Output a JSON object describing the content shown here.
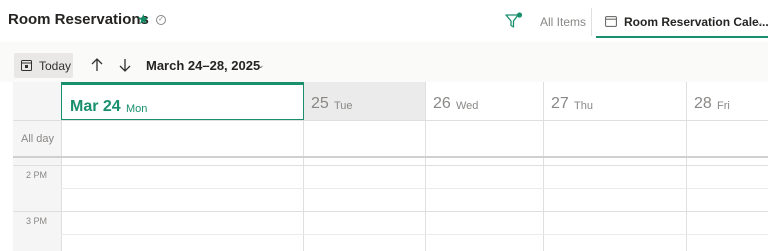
{
  "header": {
    "title": "Room Reservations",
    "star_icon": "star-icon",
    "status_icon": "check-circle-icon",
    "filter_icon": "filter-icon",
    "all_items_label": "All Items",
    "current_view": "Room Reservation Cale...",
    "accent": "#1a8f6e"
  },
  "toolbar": {
    "today_label": "Today",
    "range_label": "March 24–28, 2025"
  },
  "calendar": {
    "days": [
      {
        "num": "Mar 24",
        "name": "Mon",
        "selected": true
      },
      {
        "num": "25",
        "name": "Tue",
        "shaded": true
      },
      {
        "num": "26",
        "name": "Wed"
      },
      {
        "num": "27",
        "name": "Thu"
      },
      {
        "num": "28",
        "name": "Fri"
      }
    ],
    "all_day_label": "All day",
    "time_labels": [
      "2 PM",
      "3 PM"
    ]
  }
}
